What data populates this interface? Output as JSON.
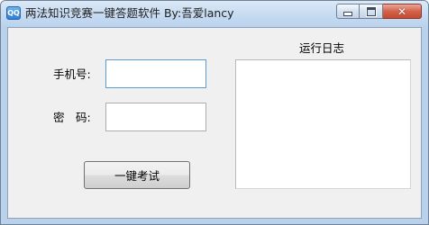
{
  "window": {
    "title": "两法知识竞赛一键答题软件 By:吾爱lancy",
    "icon_glyph": "QQ",
    "icon_name": "app-icon",
    "controls": {
      "minimize": "minimize-icon",
      "maximize": "maximize-icon",
      "close": "close-icon",
      "close_glyph": "✕"
    }
  },
  "form": {
    "phone_label": "手机号:",
    "phone_value": "",
    "password_label": "密　码:",
    "password_value": "",
    "submit_label": "一键考试"
  },
  "log": {
    "title": "运行日志",
    "content": ""
  },
  "colors": {
    "client_bg": "#f0f0f0",
    "frame": "#b9d1ea",
    "close_button": "#c74a31",
    "focus_border": "#5b9bd5"
  }
}
